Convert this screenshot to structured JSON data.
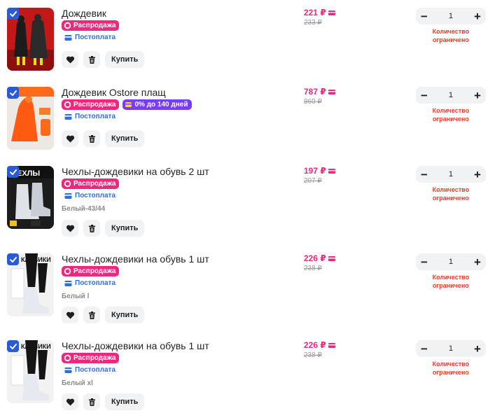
{
  "labels": {
    "sale": "Распродажа",
    "postpay": "Постоплата",
    "buy": "Купить",
    "limited_line1": "Количество",
    "limited_line2": "ограничено"
  },
  "items": [
    {
      "title": "Дождевик",
      "price": "221 ₽",
      "old_price": "233 ₽",
      "qty": "1",
      "installment": "",
      "variant": ""
    },
    {
      "title": "Дождевик Ostore плащ",
      "price": "787 ₽",
      "old_price": "860 ₽",
      "qty": "1",
      "installment": "0% до 140 дней",
      "variant": ""
    },
    {
      "title": "Чехлы-дождевики на обувь 2 шт",
      "price": "197 ₽",
      "old_price": "207 ₽",
      "qty": "1",
      "installment": "",
      "variant": "Белый-43/44"
    },
    {
      "title": "Чехлы-дождевики на обувь 1 шт",
      "price": "226 ₽",
      "old_price": "238 ₽",
      "qty": "1",
      "installment": "",
      "variant": "Белый l"
    },
    {
      "title": "Чехлы-дождевики на обувь 1 шт",
      "price": "226 ₽",
      "old_price": "238 ₽",
      "qty": "1",
      "installment": "",
      "variant": "Белый xl"
    }
  ],
  "colors": {
    "accent_blue": "#2a5bd7",
    "sale_pink": "#f0277f",
    "installment_purple": "#7a3cf0",
    "limited_red": "#ee3a26"
  },
  "icons": [
    "checkbox-checked-icon",
    "heart-icon",
    "trash-icon",
    "card-icon",
    "wallet-icon",
    "sale-ring-icon",
    "coins-icon",
    "minus-icon",
    "plus-icon"
  ]
}
